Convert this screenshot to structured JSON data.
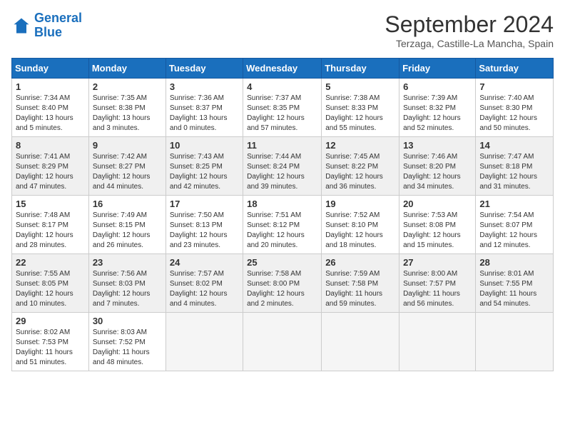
{
  "logo": {
    "line1": "General",
    "line2": "Blue"
  },
  "title": "September 2024",
  "location": "Terzaga, Castille-La Mancha, Spain",
  "headers": [
    "Sunday",
    "Monday",
    "Tuesday",
    "Wednesday",
    "Thursday",
    "Friday",
    "Saturday"
  ],
  "weeks": [
    {
      "shaded": false,
      "days": [
        {
          "num": "1",
          "info": "Sunrise: 7:34 AM\nSunset: 8:40 PM\nDaylight: 13 hours\nand 5 minutes."
        },
        {
          "num": "2",
          "info": "Sunrise: 7:35 AM\nSunset: 8:38 PM\nDaylight: 13 hours\nand 3 minutes."
        },
        {
          "num": "3",
          "info": "Sunrise: 7:36 AM\nSunset: 8:37 PM\nDaylight: 13 hours\nand 0 minutes."
        },
        {
          "num": "4",
          "info": "Sunrise: 7:37 AM\nSunset: 8:35 PM\nDaylight: 12 hours\nand 57 minutes."
        },
        {
          "num": "5",
          "info": "Sunrise: 7:38 AM\nSunset: 8:33 PM\nDaylight: 12 hours\nand 55 minutes."
        },
        {
          "num": "6",
          "info": "Sunrise: 7:39 AM\nSunset: 8:32 PM\nDaylight: 12 hours\nand 52 minutes."
        },
        {
          "num": "7",
          "info": "Sunrise: 7:40 AM\nSunset: 8:30 PM\nDaylight: 12 hours\nand 50 minutes."
        }
      ]
    },
    {
      "shaded": true,
      "days": [
        {
          "num": "8",
          "info": "Sunrise: 7:41 AM\nSunset: 8:29 PM\nDaylight: 12 hours\nand 47 minutes."
        },
        {
          "num": "9",
          "info": "Sunrise: 7:42 AM\nSunset: 8:27 PM\nDaylight: 12 hours\nand 44 minutes."
        },
        {
          "num": "10",
          "info": "Sunrise: 7:43 AM\nSunset: 8:25 PM\nDaylight: 12 hours\nand 42 minutes."
        },
        {
          "num": "11",
          "info": "Sunrise: 7:44 AM\nSunset: 8:24 PM\nDaylight: 12 hours\nand 39 minutes."
        },
        {
          "num": "12",
          "info": "Sunrise: 7:45 AM\nSunset: 8:22 PM\nDaylight: 12 hours\nand 36 minutes."
        },
        {
          "num": "13",
          "info": "Sunrise: 7:46 AM\nSunset: 8:20 PM\nDaylight: 12 hours\nand 34 minutes."
        },
        {
          "num": "14",
          "info": "Sunrise: 7:47 AM\nSunset: 8:18 PM\nDaylight: 12 hours\nand 31 minutes."
        }
      ]
    },
    {
      "shaded": false,
      "days": [
        {
          "num": "15",
          "info": "Sunrise: 7:48 AM\nSunset: 8:17 PM\nDaylight: 12 hours\nand 28 minutes."
        },
        {
          "num": "16",
          "info": "Sunrise: 7:49 AM\nSunset: 8:15 PM\nDaylight: 12 hours\nand 26 minutes."
        },
        {
          "num": "17",
          "info": "Sunrise: 7:50 AM\nSunset: 8:13 PM\nDaylight: 12 hours\nand 23 minutes."
        },
        {
          "num": "18",
          "info": "Sunrise: 7:51 AM\nSunset: 8:12 PM\nDaylight: 12 hours\nand 20 minutes."
        },
        {
          "num": "19",
          "info": "Sunrise: 7:52 AM\nSunset: 8:10 PM\nDaylight: 12 hours\nand 18 minutes."
        },
        {
          "num": "20",
          "info": "Sunrise: 7:53 AM\nSunset: 8:08 PM\nDaylight: 12 hours\nand 15 minutes."
        },
        {
          "num": "21",
          "info": "Sunrise: 7:54 AM\nSunset: 8:07 PM\nDaylight: 12 hours\nand 12 minutes."
        }
      ]
    },
    {
      "shaded": true,
      "days": [
        {
          "num": "22",
          "info": "Sunrise: 7:55 AM\nSunset: 8:05 PM\nDaylight: 12 hours\nand 10 minutes."
        },
        {
          "num": "23",
          "info": "Sunrise: 7:56 AM\nSunset: 8:03 PM\nDaylight: 12 hours\nand 7 minutes."
        },
        {
          "num": "24",
          "info": "Sunrise: 7:57 AM\nSunset: 8:02 PM\nDaylight: 12 hours\nand 4 minutes."
        },
        {
          "num": "25",
          "info": "Sunrise: 7:58 AM\nSunset: 8:00 PM\nDaylight: 12 hours\nand 2 minutes."
        },
        {
          "num": "26",
          "info": "Sunrise: 7:59 AM\nSunset: 7:58 PM\nDaylight: 11 hours\nand 59 minutes."
        },
        {
          "num": "27",
          "info": "Sunrise: 8:00 AM\nSunset: 7:57 PM\nDaylight: 11 hours\nand 56 minutes."
        },
        {
          "num": "28",
          "info": "Sunrise: 8:01 AM\nSunset: 7:55 PM\nDaylight: 11 hours\nand 54 minutes."
        }
      ]
    },
    {
      "shaded": false,
      "days": [
        {
          "num": "29",
          "info": "Sunrise: 8:02 AM\nSunset: 7:53 PM\nDaylight: 11 hours\nand 51 minutes."
        },
        {
          "num": "30",
          "info": "Sunrise: 8:03 AM\nSunset: 7:52 PM\nDaylight: 11 hours\nand 48 minutes."
        },
        {
          "num": "",
          "info": ""
        },
        {
          "num": "",
          "info": ""
        },
        {
          "num": "",
          "info": ""
        },
        {
          "num": "",
          "info": ""
        },
        {
          "num": "",
          "info": ""
        }
      ]
    }
  ]
}
